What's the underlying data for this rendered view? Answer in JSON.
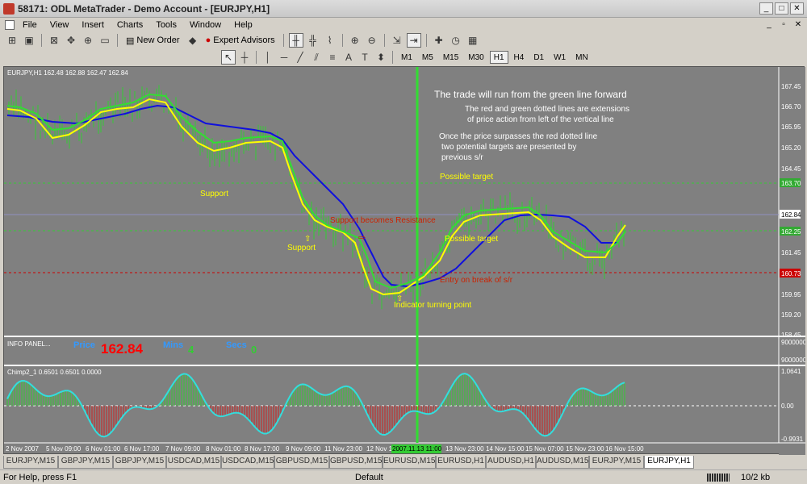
{
  "window": {
    "title": "58171: ODL MetaTrader - Demo Account - [EURJPY,H1]",
    "minimize": "_",
    "maximize": "□",
    "close": "✕"
  },
  "menu": {
    "items": [
      "File",
      "View",
      "Insert",
      "Charts",
      "Tools",
      "Window",
      "Help"
    ],
    "mdi": [
      "_",
      "▫",
      "✕"
    ]
  },
  "toolbar": {
    "new_order": "New Order",
    "expert_advisors": "Expert Advisors",
    "timeframes": [
      "M1",
      "M5",
      "M15",
      "M30",
      "H1",
      "H4",
      "D1",
      "W1",
      "MN"
    ],
    "active_timeframe": "H1",
    "text_tool": "T"
  },
  "chart": {
    "header": "EURJPY,H1  162.48 162.88 162.47 162.84",
    "annotations": {
      "line1": "The trade will run from the green line forward",
      "line2": "The red and green dotted lines are extensions",
      "line3": "of price action from left of the vertical line",
      "line4": "Once the price surpasses the red dotted line",
      "line5": "two potential targets are presented by",
      "line6": "previous s/r",
      "support1": "Support",
      "support2": "Support",
      "support_resistance": "Support becomes Resistance",
      "possible_target1": "Possible target",
      "possible_target2": "Possible target",
      "break_entry": "Entry on break of s/r",
      "turning_point": "Indicator turning point"
    },
    "price_axis": [
      "167.45",
      "166.70",
      "165.95",
      "165.20",
      "164.45",
      "163.70",
      "162.84",
      "162.25",
      "161.45",
      "160.73",
      "159.95",
      "159.20",
      "158.45"
    ],
    "current_price_tag": "162.84",
    "green_line_tag": "163.70",
    "green_dotted_tag": "162.25",
    "red_dotted_tag": "160.73",
    "colors": {
      "background": "#808080",
      "price_bars": "#33cc33",
      "yellow_line": "#ffff00",
      "green_line": "#33dd33",
      "blue_line": "#0000cc",
      "red_level": "#cc0000",
      "accent_label_red": "#cc2200"
    }
  },
  "info_panel": {
    "title": "INFO PANEL...",
    "price_label": "Price",
    "price_value": "162.84",
    "mins_label": "Mins",
    "mins_value": "4",
    "secs_label": "Secs",
    "secs_value": "0",
    "axis_top": "9000000",
    "axis_bottom": "9000000"
  },
  "oscillator": {
    "header": "Chimp2_1 0.6501 0.6501 0.0000",
    "axis_top": "1.0641",
    "axis_mid": "0.00",
    "axis_bottom": "-0.9931"
  },
  "time_axis": [
    "2 Nov 2007",
    "5 Nov 09:00",
    "6 Nov 01:00",
    "6 Nov 17:00",
    "7 Nov 09:00",
    "8 Nov 01:00",
    "8 Nov 17:00",
    "9 Nov 09:00",
    "11 Nov 23:00",
    "12 Nov 15:00",
    "2007.11.13 11:00",
    "13 Nov 23:00",
    "14 Nov 15:00",
    "15 Nov 07:00",
    "15 Nov 23:00",
    "16 Nov 15:00"
  ],
  "tabs": [
    "EURJPY,M15",
    "GBPJPY,M15",
    "GBPJPY,M15",
    "USDCAD,M15",
    "USDCAD,M15",
    "GBPUSD,M15",
    "GBPUSD,M15",
    "EURUSD,M15",
    "EURUSD,H1",
    "AUDUSD,H1",
    "AUDUSD,M15",
    "EURJPY,M15",
    "EURJPY,H1"
  ],
  "active_tab_index": 12,
  "status": {
    "help": "For Help, press F1",
    "profile": "Default",
    "traffic": "10/2 kb"
  }
}
